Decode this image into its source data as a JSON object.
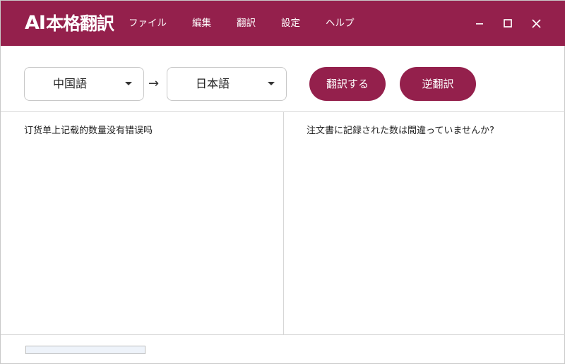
{
  "app": {
    "logo_ai": "AI",
    "logo_name": "本格翻訳"
  },
  "menu": [
    "ファイル",
    "編集",
    "翻訳",
    "設定",
    "ヘルプ"
  ],
  "window_controls": [
    "minimize-icon",
    "maximize-icon",
    "close-icon"
  ],
  "toolbar": {
    "source_language": "中国語",
    "arrow": "→",
    "target_language": "日本語",
    "translate_button": "翻訳する",
    "back_translate_button": "逆翻訳"
  },
  "source_text": "订货单上记载的数量没有错误吗",
  "target_text": "注文書に記録された数は間違っていませんか?",
  "status": {
    "progress": 0
  },
  "colors": {
    "accent": "#94204c",
    "background": "#ffffff",
    "border": "#d6d6d6"
  }
}
